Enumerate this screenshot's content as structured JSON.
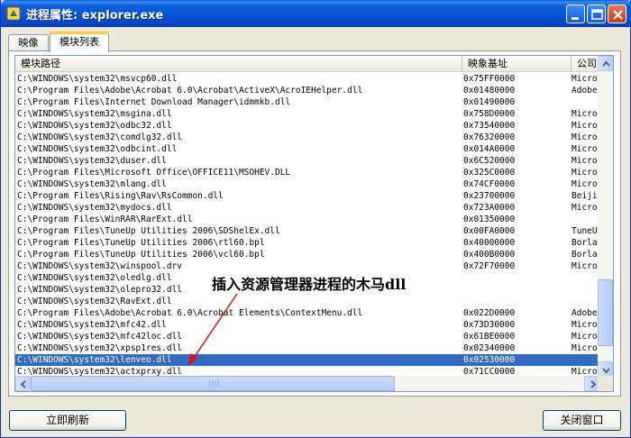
{
  "window": {
    "title": "进程属性: explorer.exe",
    "controls": {
      "minimize_icon": "minimize-icon",
      "maximize_icon": "maximize-icon",
      "close_icon": "close-icon"
    }
  },
  "tabs": [
    {
      "label": "映像",
      "active": false
    },
    {
      "label": "模块列表",
      "active": true
    }
  ],
  "list": {
    "columns": [
      "模块路径",
      "映象基址",
      "公司"
    ],
    "rows": [
      {
        "path": "C:\\WINDOWS\\system32\\msvcp60.dll",
        "base": "0x75FF0000",
        "company": "Micro"
      },
      {
        "path": "C:\\Program Files\\Adobe\\Acrobat 6.0\\Acrobat\\ActiveX\\AcroIEHelper.dll",
        "base": "0x01480000",
        "company": "Adobe"
      },
      {
        "path": "C:\\Program Files\\Internet Download Manager\\idmmkb.dll",
        "base": "0x01490000",
        "company": ""
      },
      {
        "path": "C:\\WINDOWS\\system32\\msgina.dll",
        "base": "0x758D0000",
        "company": "Micro"
      },
      {
        "path": "C:\\WINDOWS\\system32\\odbc32.dll",
        "base": "0x73540000",
        "company": "Micro"
      },
      {
        "path": "C:\\WINDOWS\\system32\\comdlg32.dll",
        "base": "0x76320000",
        "company": "Micro"
      },
      {
        "path": "C:\\WINDOWS\\system32\\odbcint.dll",
        "base": "0x014A0000",
        "company": "Micro"
      },
      {
        "path": "C:\\WINDOWS\\system32\\duser.dll",
        "base": "0x6C520000",
        "company": "Micro"
      },
      {
        "path": "C:\\Program Files\\Microsoft Office\\OFFICE11\\MSOHEV.DLL",
        "base": "0x325C0000",
        "company": "Micro"
      },
      {
        "path": "C:\\WINDOWS\\system32\\mlang.dll",
        "base": "0x74CF0000",
        "company": "Micro"
      },
      {
        "path": "C:\\Program Files\\Rising\\Rav\\RsCommon.dll",
        "base": "0x23700000",
        "company": "Beiji"
      },
      {
        "path": "C:\\WINDOWS\\system32\\mydocs.dll",
        "base": "0x723A0000",
        "company": "Micro"
      },
      {
        "path": "C:\\Program Files\\WinRAR\\RarExt.dll",
        "base": "0x01350000",
        "company": ""
      },
      {
        "path": "C:\\Program Files\\TuneUp Utilities 2006\\SDShelEx.dll",
        "base": "0x00FA0000",
        "company": "TuneU"
      },
      {
        "path": "C:\\Program Files\\TuneUp Utilities 2006\\rtl60.bpl",
        "base": "0x40000000",
        "company": "Borla"
      },
      {
        "path": "C:\\Program Files\\TuneUp Utilities 2006\\vcl60.bpl",
        "base": "0x400B0000",
        "company": "Borla"
      },
      {
        "path": "C:\\WINDOWS\\system32\\winspool.drv",
        "base": "0x72F70000",
        "company": "Micro"
      },
      {
        "path": "C:\\WINDOWS\\system32\\oledlg.dll",
        "base": "",
        "company": ""
      },
      {
        "path": "C:\\WINDOWS\\system32\\olepro32.dll",
        "base": "",
        "company": ""
      },
      {
        "path": "C:\\WINDOWS\\system32\\RavExt.dll",
        "base": "",
        "company": ""
      },
      {
        "path": "C:\\Program Files\\Adobe\\Acrobat 6.0\\Acrobat Elements\\ContextMenu.dll",
        "base": "0x022D0000",
        "company": "Adobe"
      },
      {
        "path": "C:\\WINDOWS\\system32\\mfc42.dll",
        "base": "0x73D30000",
        "company": "Micro"
      },
      {
        "path": "C:\\WINDOWS\\system32\\mfc42loc.dll",
        "base": "0x61BE0000",
        "company": "Micro"
      },
      {
        "path": "C:\\WINDOWS\\system32\\xpsp1res.dll",
        "base": "0x02340000",
        "company": "Micro"
      },
      {
        "path": "C:\\WINDOWS\\system32\\lenveo.dll",
        "base": "0x02530000",
        "company": "",
        "selected": true
      },
      {
        "path": "C:\\WINDOWS\\system32\\actxprxy.dll",
        "base": "0x71CC0000",
        "company": "Micro"
      }
    ]
  },
  "annotation": {
    "text": "插入资源管理器进程的木马dll"
  },
  "buttons": {
    "refresh": "立即刷新",
    "close": "关闭窗口"
  }
}
